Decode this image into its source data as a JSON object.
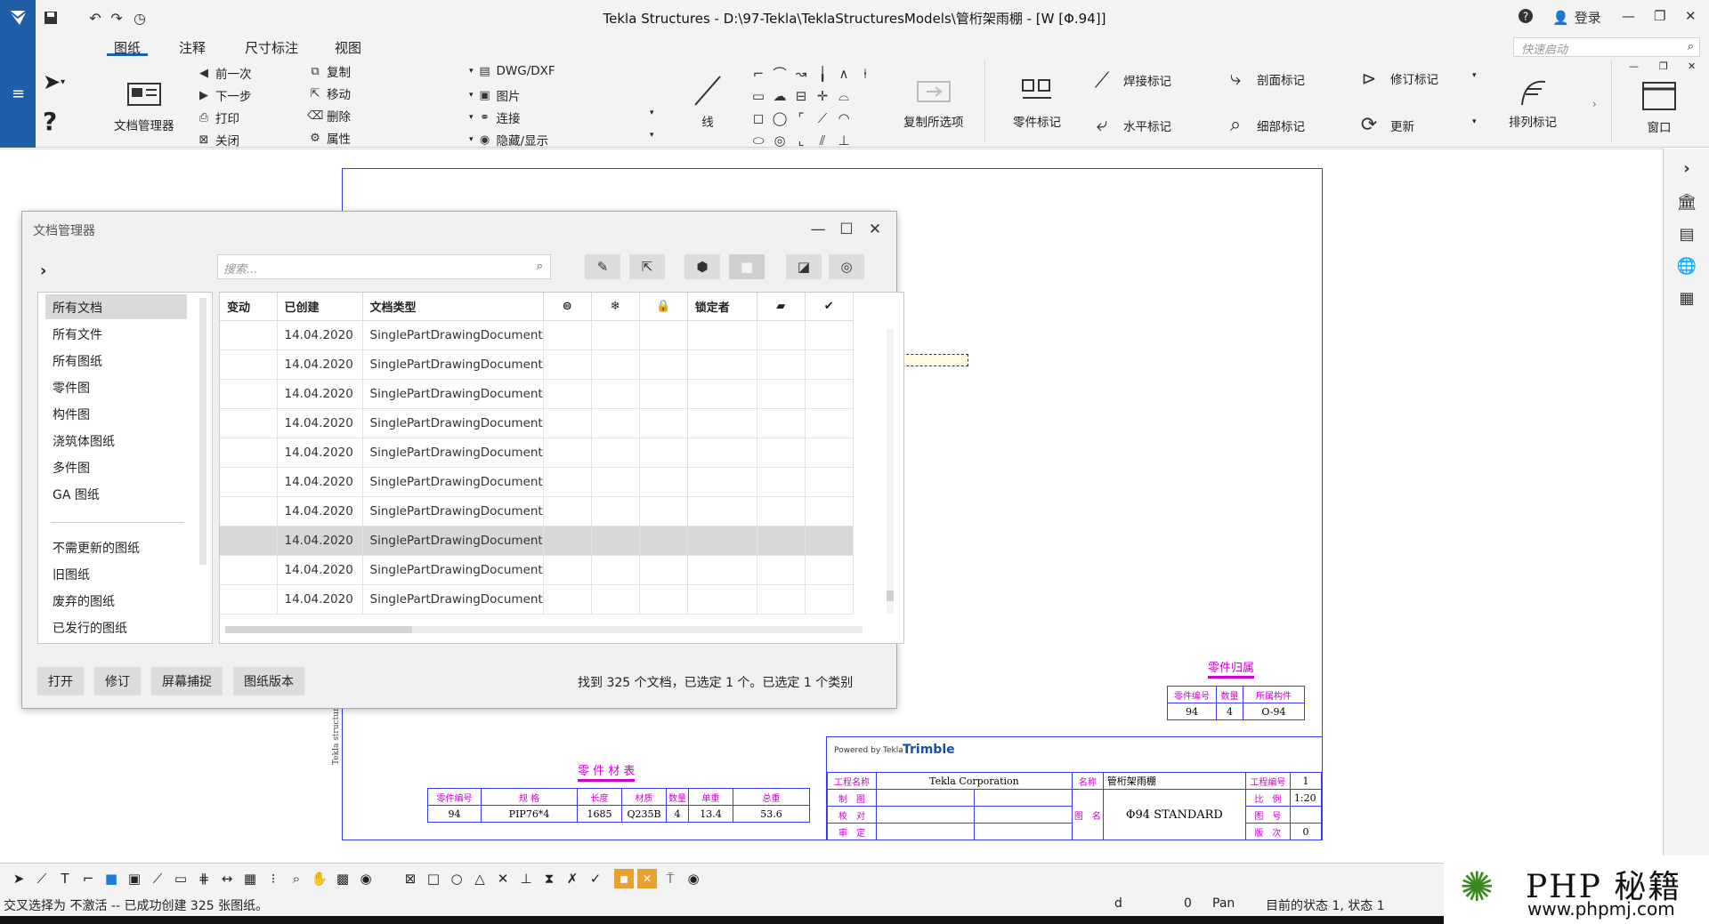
{
  "window": {
    "title": "Tekla Structures - D:\\97-Tekla\\TeklaStructuresModels\\管桁架雨棚 - [W  [Φ.94]]",
    "login": "登录"
  },
  "ribbon": {
    "tabs": [
      "图纸",
      "注释",
      "尺寸标注",
      "视图"
    ],
    "quick_launch_placeholder": "快速启动",
    "doc_manager": "文档管理器",
    "nav": [
      "前一次",
      "下一步",
      "打印",
      "关闭"
    ],
    "edit": [
      "复制",
      "移动",
      "删除",
      "属性"
    ],
    "insert": [
      "DWG/DXF",
      "图片",
      "连接",
      "隐藏/显示"
    ],
    "line": "线",
    "copy_options": "复制所选项",
    "part_mark": "零件标记",
    "weld_mark": "焊接标记",
    "level_mark": "水平标记",
    "section_mark": "剖面标记",
    "detail_mark": "细部标记",
    "revision_mark": "修订标记",
    "update": "更新",
    "arrange_marks": "排列标记",
    "window": "窗口"
  },
  "dialog": {
    "title": "文档管理器",
    "search_placeholder": "搜索...",
    "categories": [
      "所有文档",
      "所有文件",
      "所有图纸",
      "零件图",
      "构件图",
      "浇筑体图纸",
      "多件图",
      "GA 图纸"
    ],
    "categories2": [
      "不需更新的图纸",
      "旧图纸",
      "废弃的图纸",
      "已发行的图纸"
    ],
    "columns": [
      "变动",
      "已创建",
      "文档类型",
      "",
      "",
      "",
      "锁定者",
      "",
      ""
    ],
    "rows": [
      {
        "created": "14.04.2020",
        "type": "SinglePartDrawingDocument"
      },
      {
        "created": "14.04.2020",
        "type": "SinglePartDrawingDocument"
      },
      {
        "created": "14.04.2020",
        "type": "SinglePartDrawingDocument"
      },
      {
        "created": "14.04.2020",
        "type": "SinglePartDrawingDocument"
      },
      {
        "created": "14.04.2020",
        "type": "SinglePartDrawingDocument"
      },
      {
        "created": "14.04.2020",
        "type": "SinglePartDrawingDocument"
      },
      {
        "created": "14.04.2020",
        "type": "SinglePartDrawingDocument"
      },
      {
        "created": "14.04.2020",
        "type": "SinglePartDrawingDocument"
      },
      {
        "created": "14.04.2020",
        "type": "SinglePartDrawingDocument"
      },
      {
        "created": "14.04.2020",
        "type": "SinglePartDrawingDocument"
      }
    ],
    "selected_row": 7,
    "buttons": [
      "打开",
      "修订",
      "屏幕捕捉",
      "图纸版本"
    ],
    "status": "找到 325 个文档，已选定 1 个。已选定 1 个类别"
  },
  "drawing": {
    "vertical_text": "Tekla structures",
    "part_owner_title": "零件归属",
    "part_owner_headers": [
      "零件编号",
      "数量",
      "所属构件"
    ],
    "part_owner_values": [
      "94",
      "4",
      "O-94"
    ],
    "parts_table_title": "零 件 材 表",
    "parts_headers": [
      "零件编号",
      "规   格",
      "长度",
      "材质",
      "数量",
      "单重",
      "总重"
    ],
    "parts_values": [
      "94",
      "PIP76*4",
      "1685",
      "Q235B",
      "4",
      "13.4",
      "53.6"
    ],
    "title_block": {
      "powered_by": "Powered by Tekla",
      "brand": "Trimble",
      "labels_left": [
        "工程名称",
        "制　图",
        "校　对",
        "审　定"
      ],
      "company": "Tekla Corporation",
      "label_name": "名称",
      "label_figname": "图　名",
      "project_name": "管桁架雨棚",
      "drawing_name": "Φ94 STANDARD",
      "labels_right": [
        "工程编号",
        "比　例",
        "图　号",
        "版　次"
      ],
      "values_right": [
        "1",
        "1:20",
        "",
        "0"
      ]
    }
  },
  "status_bar": {
    "left": "交叉选择为 不激活 -- 已成功创建 325 张图纸。",
    "d": "d",
    "zero": "0",
    "pan": "Pan",
    "state": "目前的状态 1, 状态 1"
  },
  "watermark": {
    "title": "PHP 秘籍",
    "url": "www.phpmj.com"
  },
  "colors": {
    "accent": "#1f5fa8",
    "drawing_blue": "#3a3af0",
    "drawing_magenta": "#d000d0"
  }
}
